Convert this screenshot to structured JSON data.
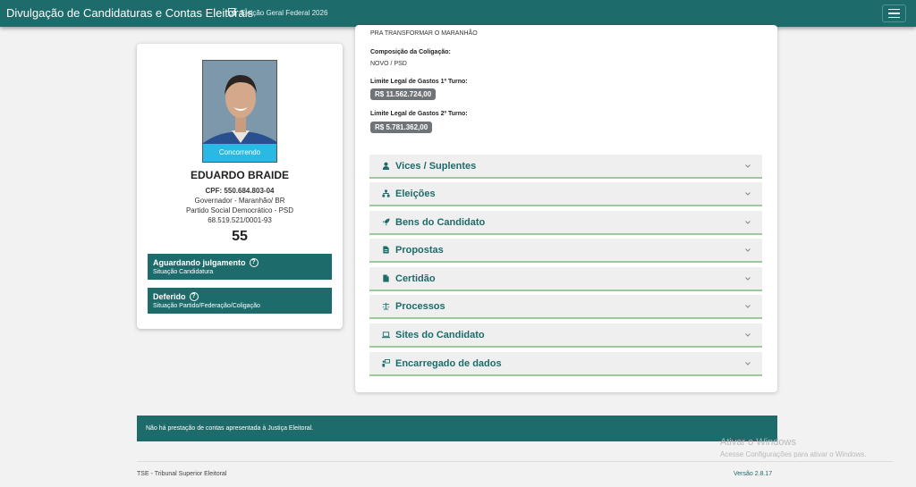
{
  "header": {
    "title": "Divulgação de Candidaturas e Contas Eleitorais",
    "election": "Eleição Geral Federal 2026"
  },
  "candidate": {
    "photo_badge": "Concorrendo",
    "name": "EDUARDO BRAIDE",
    "cpf": "CPF: 550.684.803-04",
    "office": "Governador - Maranhão/ BR",
    "party": "Partido Social Democrático - PSD",
    "cnpj": "68.519.521/0001-93",
    "number": "55",
    "status_candidacy": {
      "title": "Aguardando julgamento",
      "subtitle": "Situação Candidatura"
    },
    "status_party": {
      "title": "Deferido",
      "subtitle": "Situação Partido/Federação/Coligação"
    }
  },
  "details": {
    "coalition_name": "PRA TRANSFORMAR O MARANHÃO",
    "composition_label": "Composição da Coligação:",
    "composition_value": "NOVO / PSD",
    "limit1_label": "Limite Legal de Gastos 1º Turno:",
    "limit1_value": "R$ 11.562.724,00",
    "limit2_label": "Limite Legal de Gastos 2º Turno:",
    "limit2_value": "R$ 5.781.362,00"
  },
  "accordion": [
    {
      "label": "Vices / Suplentes",
      "icon": "user-icon"
    },
    {
      "label": "Eleições",
      "icon": "sitemap-icon"
    },
    {
      "label": "Bens do Candidato",
      "icon": "rocket-icon"
    },
    {
      "label": "Propostas",
      "icon": "document-icon"
    },
    {
      "label": "Certidão",
      "icon": "file-icon"
    },
    {
      "label": "Processos",
      "icon": "scale-icon"
    },
    {
      "label": "Sites do Candidato",
      "icon": "laptop-icon"
    },
    {
      "label": "Encarregado de dados",
      "icon": "person-board-icon"
    }
  ],
  "footer": {
    "notice": "Não há prestação de contas apresentada à Justiça Eleitoral.",
    "org": "TSE - Tribunal Superior Eleitoral",
    "version": "Versão 2.8.17"
  },
  "watermark": {
    "line1": "Ativar o Windows",
    "line2": "Acesse Configurações para ativar o Windows."
  },
  "colors": {
    "primary": "#1e6b6b",
    "badge": "#29b9e4",
    "money_tag": "#6f7478",
    "accordion_border": "#9cc99c"
  }
}
